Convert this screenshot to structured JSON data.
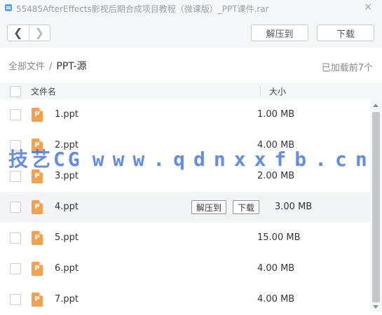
{
  "window": {
    "title": "55485AfterEffects影视后期合成项目教程（微课版）_PPT课件.rar",
    "close_glyph": "×"
  },
  "toolbar": {
    "back_glyph": "❮",
    "forward_glyph": "❯",
    "extract_label": "解压到",
    "download_label": "下载"
  },
  "breadcrumb": {
    "root": "全部文件",
    "separator": "/",
    "current": "PPT-源"
  },
  "status": {
    "loaded_text": "已加载前7个"
  },
  "columns": {
    "name": "文件名",
    "size": "大小"
  },
  "files": [
    {
      "name": "1.ppt",
      "size": "1.00 MB",
      "icon_letter": "P"
    },
    {
      "name": "2.ppt",
      "size": "4.00 MB",
      "icon_letter": "P"
    },
    {
      "name": "3.ppt",
      "size": "2.00 MB",
      "icon_letter": "P"
    },
    {
      "name": "4.ppt",
      "size": "3.00 MB",
      "icon_letter": "P",
      "hovered": true
    },
    {
      "name": "5.ppt",
      "size": "15.00 MB",
      "icon_letter": "P"
    },
    {
      "name": "6.ppt",
      "size": "4.00 MB",
      "icon_letter": "P"
    },
    {
      "name": "7.ppt",
      "size": "4.00 MB",
      "icon_letter": "P"
    }
  ],
  "row_actions": {
    "extract_label": "解压到",
    "download_label": "下载"
  },
  "watermark": {
    "brand": "技艺CG",
    "url": "www.qdnxxfb.cn"
  },
  "colors": {
    "ppt_icon": "#f5a04b",
    "watermark": "#3d6ff2",
    "titlebar_bg": "#f5f6f8"
  }
}
